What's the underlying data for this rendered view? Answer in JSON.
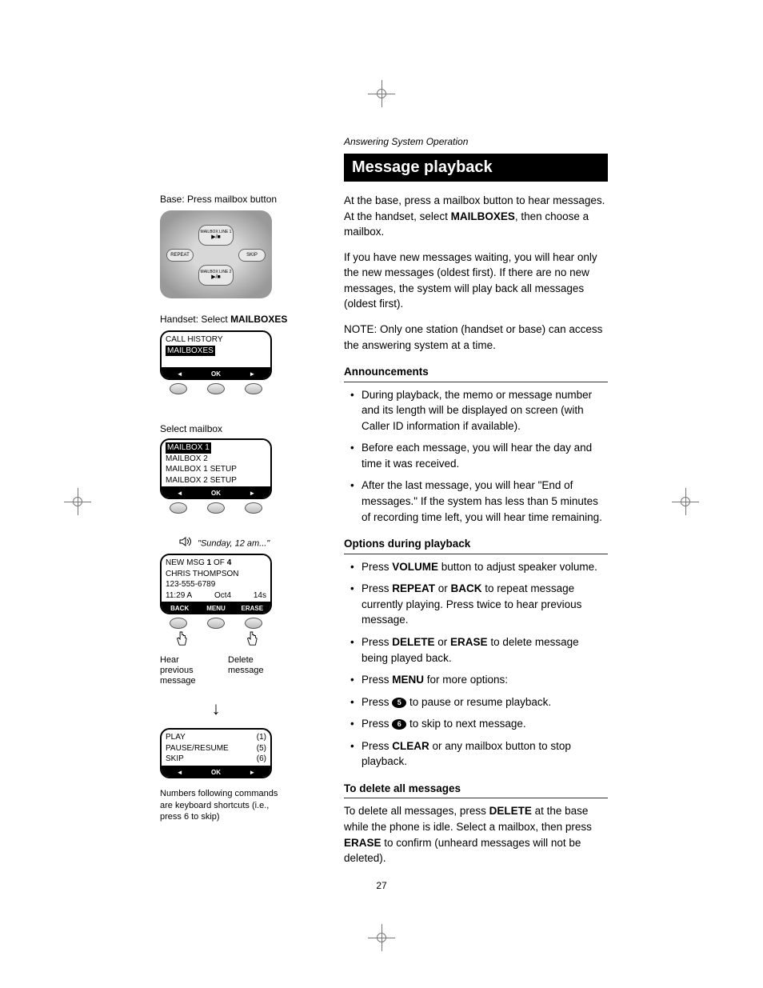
{
  "header": "Answering System Operation",
  "title": "Message playback",
  "page_number": "27",
  "intro": {
    "p1_a": "At the base, press a mailbox button to hear messages. At the handset, select ",
    "p1_bold": "MAILBOXES",
    "p1_b": ", then choose a mailbox.",
    "p2": "If you have new messages waiting, you will hear only the new messages (oldest first). If there are no new messages, the system will play back all messages (oldest first).",
    "p3": "NOTE: Only one station (handset or base) can access the answering system at a time."
  },
  "sections": {
    "announcements": {
      "heading": "Announcements",
      "items": [
        "During playback, the memo or message number and its length will be displayed on screen (with Caller ID information if available).",
        "Before each message, you will hear the day and time it was received.",
        "After the last message, you will hear \"End of messages.\" If the system has less than 5 minutes of recording time left, you will hear time remaining."
      ]
    },
    "options": {
      "heading": "Options during playback",
      "items": [
        {
          "pre": "Press ",
          "b": "VOLUME",
          "post": " button to adjust speaker volume."
        },
        {
          "pre": "Press ",
          "b": "REPEAT",
          "mid": " or ",
          "b2": "BACK",
          "post": " to repeat message currently playing. Press twice to hear previous message."
        },
        {
          "pre": "Press ",
          "b": "DELETE",
          "mid": " or ",
          "b2": "ERASE",
          "post": " to delete message being played back."
        },
        {
          "pre": "Press ",
          "b": "MENU",
          "post": " for more options:"
        },
        {
          "pre": "Press ",
          "key": "5",
          "post": " to pause or resume playback."
        },
        {
          "pre": "Press ",
          "key": "6",
          "post": " to skip to next message."
        },
        {
          "pre": "Press ",
          "b": "CLEAR",
          "post": " or any mailbox button to stop playback."
        }
      ]
    },
    "delete": {
      "heading": "To delete all messages",
      "p_a": "To delete all messages, press ",
      "p_b": "DELETE",
      "p_c": " at the base while the phone is idle. Select a mailbox, then press ",
      "p_d": "ERASE",
      "p_e": " to confirm (unheard messages will not be deleted)."
    }
  },
  "sidebar": {
    "base_caption": "Base: Press mailbox button",
    "base_buttons": {
      "line1": "MAILBOX\nLINE 1",
      "line2": "MAILBOX\nLINE 2",
      "repeat": "REPEAT",
      "skip": "SKIP"
    },
    "playicon": "▶/■",
    "handset_caption_a": "Handset: Select ",
    "handset_caption_b": "MAILBOXES",
    "screen1": {
      "row1": "CALL HISTORY",
      "row2": "MAILBOXES",
      "soft": [
        "◄",
        "OK",
        "►"
      ]
    },
    "select_caption": "Select mailbox",
    "screen2": {
      "row1": "MAILBOX 1",
      "row2": "MAILBOX 2",
      "row3": "MAILBOX 1 SETUP",
      "row4": "MAILBOX 2 SETUP",
      "soft": [
        "◄",
        "OK",
        "►"
      ]
    },
    "audio_hint": "\"Sunday, 12 am...\"",
    "screen3": {
      "line1_a": "NEW MSG ",
      "line1_b": "1",
      "line1_c": " OF ",
      "line1_d": "4",
      "line2": "CHRIS THOMPSON",
      "line3": "123-555-6789",
      "line4_a": "11:29 A",
      "line4_b": "Oct4",
      "line4_c": "14s",
      "soft": [
        "BACK",
        "MENU",
        "ERASE"
      ]
    },
    "col_left": "Hear previous message",
    "col_right": "Delete message",
    "screen4": {
      "row1": "PLAY",
      "n1": "(1)",
      "row2": "PAUSE/RESUME",
      "n2": "(5)",
      "row3": "SKIP",
      "n3": "(6)",
      "soft": [
        "◄",
        "OK",
        "►"
      ]
    },
    "footnote": "Numbers following commands are keyboard shortcuts (i.e., press 6 to skip)"
  }
}
